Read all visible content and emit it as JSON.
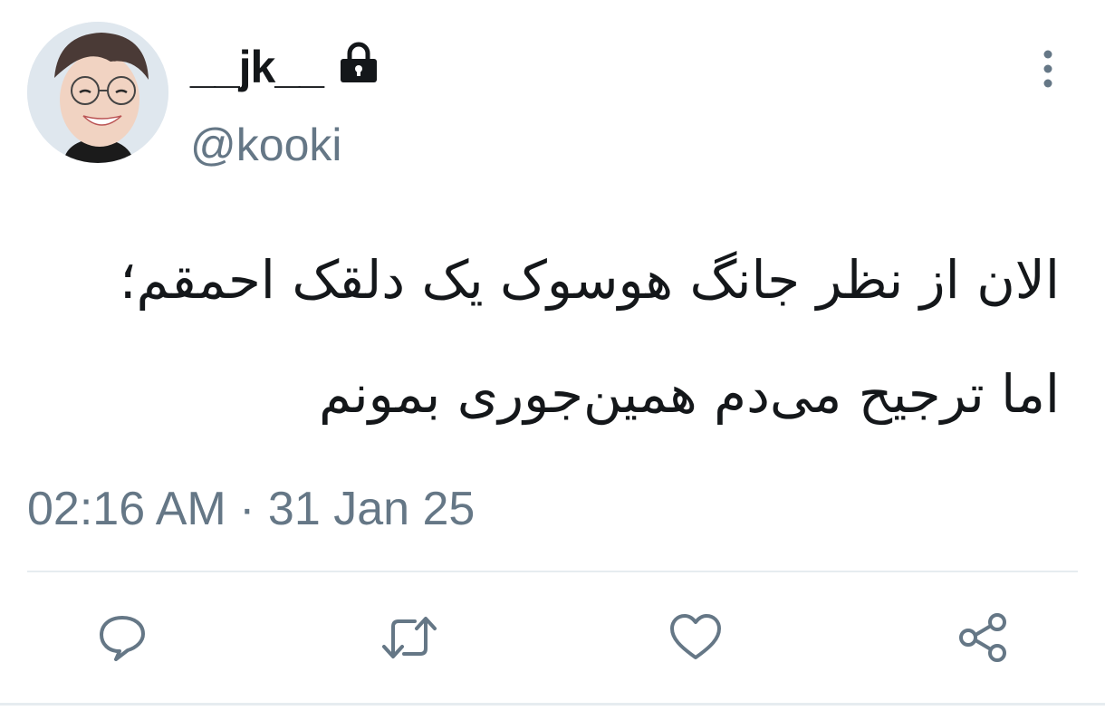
{
  "user": {
    "display_name": "__jk__",
    "handle": "@kooki",
    "protected_icon": "lock-icon",
    "avatar": "avatar"
  },
  "menu_icon": "more-vertical-icon",
  "tweet": {
    "text_lines": [
      "الان از نظر جانگ هوسوک یک دلقک احمقم؛",
      "اما ترجیح می‌دم همین‌جوری بمونم"
    ],
    "timestamp": "02:16 AM · 31 Jan 25"
  },
  "actions": [
    {
      "icon": "reply-icon"
    },
    {
      "icon": "retweet-icon"
    },
    {
      "icon": "like-icon"
    },
    {
      "icon": "share-icon"
    }
  ],
  "colors": {
    "text": "#14171a",
    "secondary": "#657786",
    "divider": "#e6ecf0"
  }
}
